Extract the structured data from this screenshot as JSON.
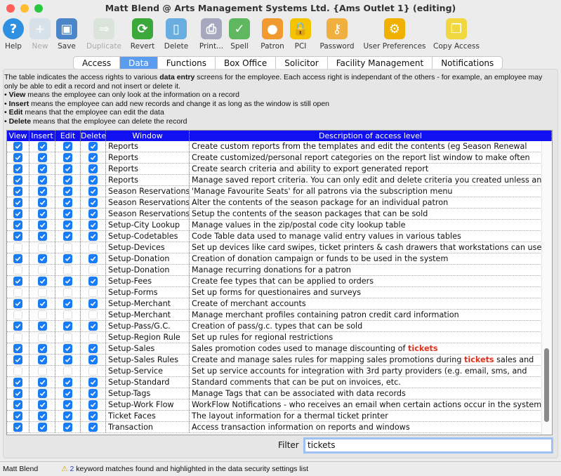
{
  "window": {
    "title": "Matt Blend @ Arts Management Systems Ltd. {Ams Outlet 1} (editing)"
  },
  "toolbar": [
    {
      "label": "Help",
      "icon": "help-icon",
      "enabled": true,
      "color": "#2f8fe0",
      "glyph": "?"
    },
    {
      "label": "New",
      "icon": "new-document-icon",
      "enabled": false,
      "color": "#c8dbe8",
      "glyph": "+"
    },
    {
      "label": "Save",
      "icon": "save-disk-icon",
      "enabled": true,
      "color": "#4b86c8",
      "glyph": "▣"
    },
    {
      "label": "Duplicate",
      "icon": "duplicate-icon",
      "enabled": false,
      "color": "#cfe0cf",
      "glyph": "⇒"
    },
    {
      "label": "Revert",
      "icon": "revert-arrows-icon",
      "enabled": true,
      "color": "#3aa83a",
      "glyph": "⟳"
    },
    {
      "label": "Delete",
      "icon": "trash-can-icon",
      "enabled": true,
      "color": "#6aaee0",
      "glyph": "▯"
    },
    {
      "label": "Print...",
      "icon": "printer-icon",
      "enabled": true,
      "color": "#a7a7c0",
      "glyph": "⎙"
    },
    {
      "label": "Spell",
      "icon": "spell-check-icon",
      "enabled": true,
      "color": "#5fb85f",
      "glyph": "✓"
    },
    {
      "label": "Patron",
      "icon": "patron-person-icon",
      "enabled": true,
      "color": "#f09a30",
      "glyph": "●"
    },
    {
      "label": "PCI",
      "icon": "padlock-icon",
      "enabled": true,
      "color": "#f5c400",
      "glyph": "🔒"
    },
    {
      "label": "Password",
      "icon": "key-icon",
      "enabled": true,
      "color": "#f0b040",
      "glyph": "⚷"
    },
    {
      "label": "User Preferences",
      "icon": "gear-icon",
      "enabled": true,
      "color": "#f0b000",
      "glyph": "⚙"
    },
    {
      "label": "Copy Access",
      "icon": "copy-clipboard-icon",
      "enabled": true,
      "color": "#f2d840",
      "glyph": "❐"
    }
  ],
  "tabs": [
    {
      "label": "Access",
      "active": false
    },
    {
      "label": "Data",
      "active": true
    },
    {
      "label": "Functions",
      "active": false
    },
    {
      "label": "Box Office",
      "active": false
    },
    {
      "label": "Solicitor",
      "active": false
    },
    {
      "label": "Facility Management",
      "active": false
    },
    {
      "label": "Notifications",
      "active": false
    }
  ],
  "intro": {
    "p1a": "The table indicates the access rights to various ",
    "p1b": "data entry",
    "p1c": " screens for the employee.  Each access right is independant of the others - for example, an employee may only be able to edit a record and not insert or delete it.",
    "bullets": [
      {
        "term": "View",
        "text": " means the employee can only look at the information on a record"
      },
      {
        "term": "Insert",
        "text": " means the employee can add new records and change it as long as the window is still open"
      },
      {
        "term": "Edit",
        "text": " means that the employee can edit the data"
      },
      {
        "term": "Delete",
        "text": " means that the employee can delete the record"
      }
    ]
  },
  "table": {
    "columns": [
      "View",
      "Insert",
      "Edit",
      "Delete",
      "Window",
      "Description of access level"
    ],
    "highlight_word": "tickets",
    "highlight_color": "#e0301e",
    "rows": [
      {
        "checked": true,
        "window": "Reports",
        "desc": "Create custom reports from the templates and edit the contents (eg Season Renewal"
      },
      {
        "checked": true,
        "window": "Reports",
        "desc": "Create customized/personal report categories on the report list window to make often"
      },
      {
        "checked": true,
        "window": "Reports",
        "desc": "Create search criteria and ability to export generated report"
      },
      {
        "checked": true,
        "window": "Reports",
        "desc": "Manage saved report criteria.  You can only edit and delete criteria you created unless an"
      },
      {
        "checked": true,
        "window": "Season Reservations",
        "desc": "'Manage Favourite Seats' for all patrons via the subscription menu"
      },
      {
        "checked": true,
        "window": "Season Reservations",
        "desc": "Alter the contents of the season package for an individual patron"
      },
      {
        "checked": true,
        "window": "Season Reservations",
        "desc": "Setup the contents of the season packages that can be sold"
      },
      {
        "checked": true,
        "window": "Setup-City Lookup",
        "desc": "Manage values in the zip/postal code city lookup table"
      },
      {
        "checked": true,
        "window": "Setup-Codetables",
        "desc": "Code Table data used to manage valid entry values in various tables"
      },
      {
        "checked": false,
        "window": "Setup-Devices",
        "desc": "Set up devices like card swipes, ticket printers & cash drawers that workstations can use"
      },
      {
        "checked": true,
        "window": "Setup-Donation",
        "desc": "Creation of donation campaign or funds to be used in the system"
      },
      {
        "checked": false,
        "window": "Setup-Donation",
        "desc": "Manage recurring donations for a patron"
      },
      {
        "checked": true,
        "window": "Setup-Fees",
        "desc": "Create fee types that can be applied to orders"
      },
      {
        "checked": false,
        "window": "Setup-Forms",
        "desc": "Set up forms for questionaires and surveys"
      },
      {
        "checked": true,
        "window": "Setup-Merchant",
        "desc": "Create of merchant accounts"
      },
      {
        "checked": false,
        "window": "Setup-Merchant",
        "desc": "Manage merchant profiles containing patron credit card information"
      },
      {
        "checked": true,
        "window": "Setup-Pass/G.C.",
        "desc": "Creation of pass/g.c. types that can be sold"
      },
      {
        "checked": false,
        "window": "Setup-Region Rule",
        "desc": "Set up rules for regional restrictions"
      },
      {
        "checked": true,
        "window": "Setup-Sales",
        "desc": "Sales promotion codes used to manage discounting of tickets"
      },
      {
        "checked": true,
        "window": "Setup-Sales Rules",
        "desc": "Create and manage sales rules for mapping sales promotions during tickets sales and"
      },
      {
        "checked": false,
        "window": "Setup-Service",
        "desc": "Set up service accounts for integration with 3rd party providers (e.g. email, sms, and"
      },
      {
        "checked": true,
        "window": "Setup-Standard",
        "desc": "Standard comments that can be put on invoices, etc."
      },
      {
        "checked": true,
        "window": "Setup-Tags",
        "desc": "Manage Tags that can be associated with data records"
      },
      {
        "checked": true,
        "window": "Setup-Work Flow",
        "desc": "WorkFlow Notifications - who receives an email when certain actions occur in the system"
      },
      {
        "checked": true,
        "window": "Ticket Faces",
        "desc": "The layout information for a thermal ticket printer"
      },
      {
        "checked": true,
        "window": "Transaction",
        "desc": "Access transaction information on reports and windows"
      }
    ]
  },
  "filter": {
    "label": "Filter",
    "value": "tickets"
  },
  "status": {
    "user": "Matt Blend",
    "match_count": "2",
    "message": " keyword matches found and highlighted in the data security settings list"
  }
}
